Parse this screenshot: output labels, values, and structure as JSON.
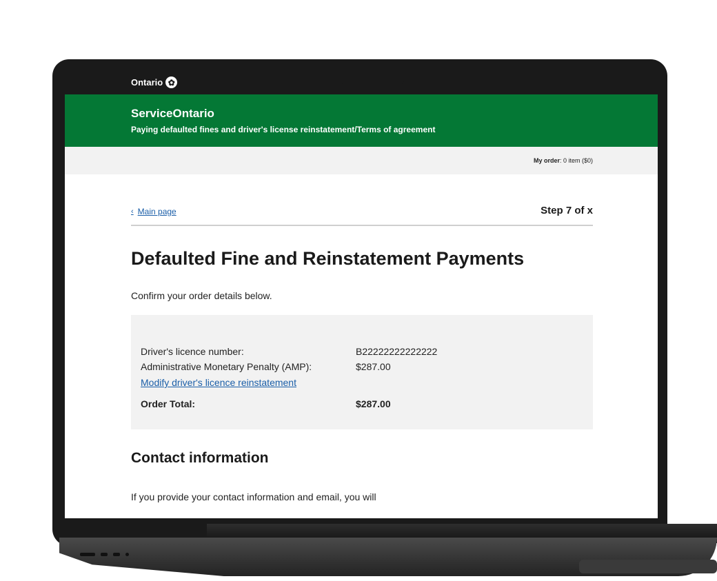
{
  "topbar": {
    "gov_name": "Ontario",
    "logo_icon": "trillium-icon"
  },
  "header": {
    "title": "ServiceOntario",
    "subtitle": "Paying defaulted fines and driver's license reinstatement/Terms of agreement",
    "bg_color": "#047835"
  },
  "order_bar": {
    "label": "My order",
    "value": ": 0 item ($0)"
  },
  "nav": {
    "back_label": "Main page",
    "step": "Step 7 of x"
  },
  "page": {
    "heading": "Defaulted Fine and Reinstatement Payments",
    "intro": "Confirm your order details below."
  },
  "summary": {
    "rows": [
      {
        "label": "Driver's licence number:",
        "value": "B22222222222222"
      },
      {
        "label": "Administrative Monetary Penalty (AMP):",
        "value": "$287.00"
      }
    ],
    "modify_link": "Modify driver's licence reinstatement",
    "total_label": "Order Total:",
    "total_value": "$287.00"
  },
  "contact": {
    "heading": "Contact information",
    "text": "If you provide your contact information and email, you will"
  },
  "colors": {
    "link": "#1a5ea8",
    "topbar": "#1a1a1a",
    "panel": "#f2f2f2"
  }
}
